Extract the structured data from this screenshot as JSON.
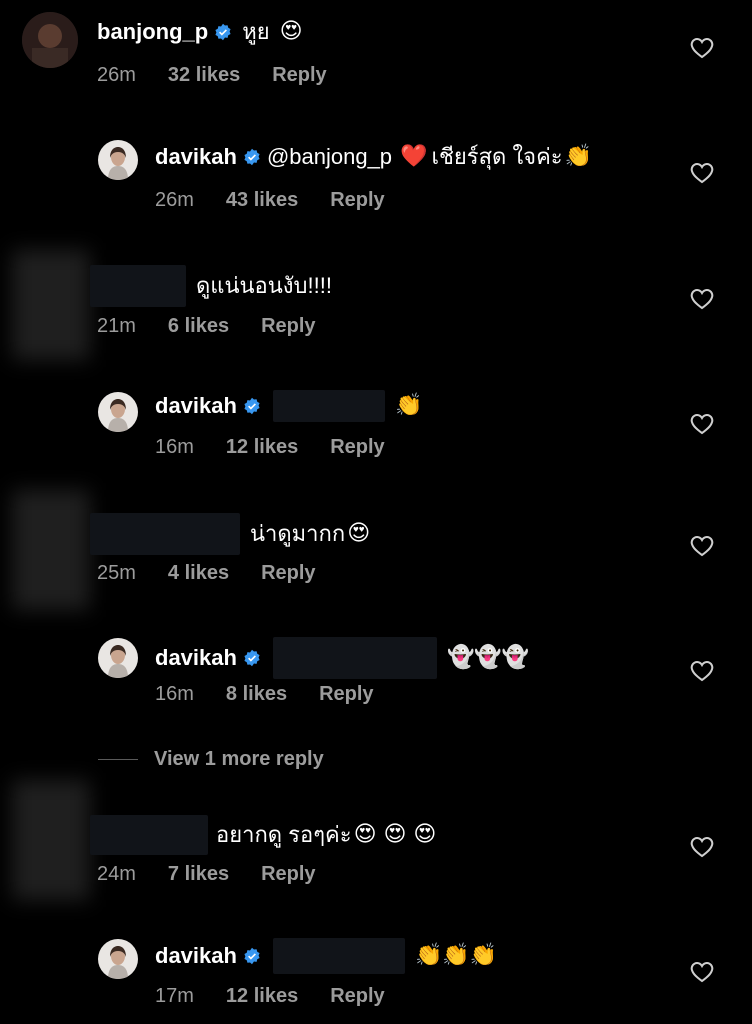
{
  "comments": [
    {
      "username": "banjong_p",
      "verified": true,
      "text": "หูย",
      "emoji": "😍",
      "time": "26m",
      "likes": "32 likes",
      "reply": "Reply"
    },
    {
      "username": "davikah",
      "verified": true,
      "mention": "@banjong_p",
      "text": "เชียร์สุด ใจค่ะ",
      "emoji_before": "❤️",
      "emoji": "👏",
      "time": "26m",
      "likes": "43 likes",
      "reply": "Reply"
    },
    {
      "username": "",
      "text": "ดูแน่นอนงับ!!!!",
      "time": "21m",
      "likes": "6 likes",
      "reply": "Reply"
    },
    {
      "username": "davikah",
      "verified": true,
      "emoji": "👏",
      "time": "16m",
      "likes": "12 likes",
      "reply": "Reply"
    },
    {
      "username": "",
      "text": "น่าดูมากก",
      "emoji": "😍",
      "time": "25m",
      "likes": "4 likes",
      "reply": "Reply"
    },
    {
      "username": "davikah",
      "verified": true,
      "emoji": "👻👻👻",
      "time": "16m",
      "likes": "8 likes",
      "reply": "Reply"
    },
    {
      "username": "",
      "text": "อยากดู รอๆค่ะ",
      "emoji": "😍 😍 😍",
      "time": "24m",
      "likes": "7 likes",
      "reply": "Reply"
    },
    {
      "username": "davikah",
      "verified": true,
      "emoji": "👏👏👏",
      "time": "17m",
      "likes": "12 likes",
      "reply": "Reply"
    }
  ],
  "view_more": "View 1 more reply",
  "icons": {
    "like": "heart-outline-icon",
    "verified": "verified-badge-icon"
  },
  "colors": {
    "background": "#000000",
    "text": "#ffffff",
    "meta": "#9c9c9c",
    "verified": "#3897f0"
  }
}
